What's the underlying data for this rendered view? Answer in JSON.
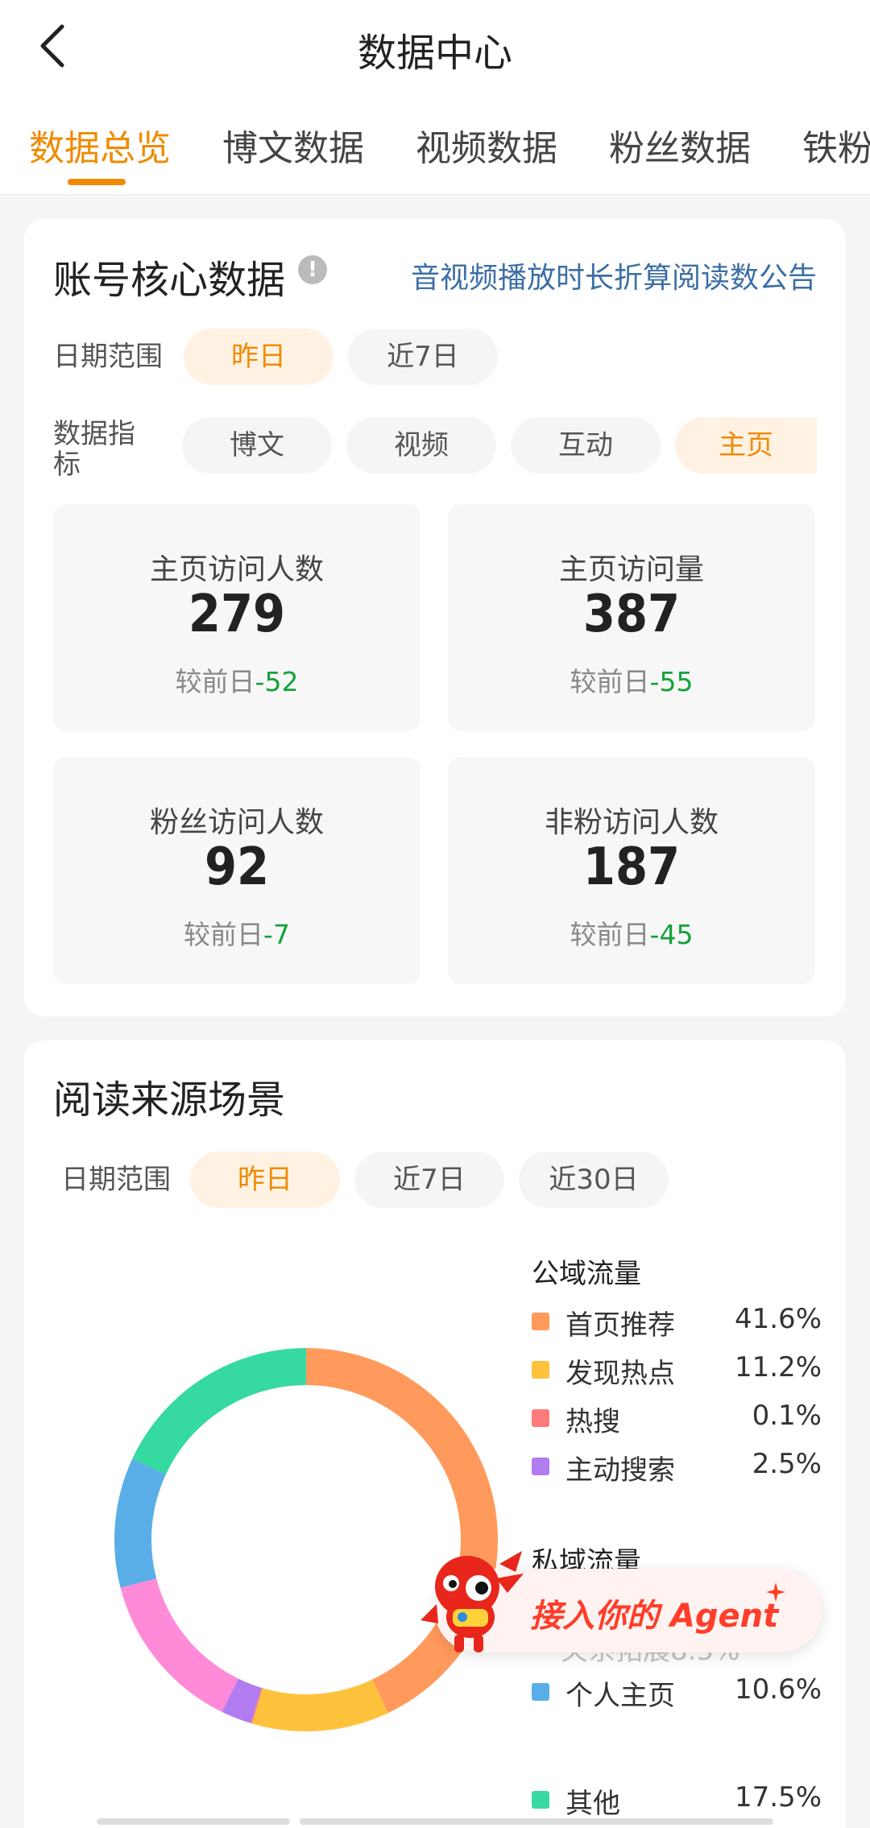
{
  "header": {
    "title": "数据中心",
    "tabs": [
      {
        "label": "数据总览",
        "active": true
      },
      {
        "label": "博文数据",
        "active": false
      },
      {
        "label": "视频数据",
        "active": false
      },
      {
        "label": "粉丝数据",
        "active": false
      },
      {
        "label": "铁粉",
        "active": false
      }
    ]
  },
  "core": {
    "title": "账号核心数据",
    "info_icon": "info-icon",
    "notice_link": "音视频播放时长折算阅读数公告",
    "date_label": "日期范围",
    "date_options": [
      {
        "label": "昨日",
        "active": true
      },
      {
        "label": "近7日",
        "active": false
      }
    ],
    "metric_label": "数据指标",
    "metric_options": [
      {
        "label": "博文",
        "active": false
      },
      {
        "label": "视频",
        "active": false
      },
      {
        "label": "互动",
        "active": false
      },
      {
        "label": "主页",
        "active": true
      }
    ],
    "stats": [
      {
        "label": "主页访问人数",
        "value": "279",
        "compare_prefix": "较前日",
        "delta": "-52"
      },
      {
        "label": "主页访问量",
        "value": "387",
        "compare_prefix": "较前日",
        "delta": "-55"
      },
      {
        "label": "粉丝访问人数",
        "value": "92",
        "compare_prefix": "较前日",
        "delta": "-7"
      },
      {
        "label": "非粉访问人数",
        "value": "187",
        "compare_prefix": "较前日",
        "delta": "-45"
      }
    ],
    "delta_color": "#12a33a"
  },
  "source": {
    "title": "阅读来源场景",
    "date_label": "日期范围",
    "date_options": [
      {
        "label": "昨日",
        "active": true
      },
      {
        "label": "近7日",
        "active": false
      },
      {
        "label": "近30日",
        "active": false
      }
    ],
    "public_label": "公域流量",
    "private_label": "私域流量",
    "public_items": [
      {
        "name": "首页推荐",
        "pct": "41.6%",
        "color": "#ff9a5c"
      },
      {
        "name": "发现热点",
        "pct": "11.2%",
        "color": "#ffc23d"
      },
      {
        "name": "热搜",
        "pct": "0.1%",
        "color": "#ff7a7a"
      },
      {
        "name": "主动搜索",
        "pct": "2.5%",
        "color": "#b07cf0"
      }
    ],
    "private_items": [
      {
        "name": "个人主页",
        "pct": "10.6%",
        "color": "#5aaee8"
      }
    ],
    "other_items": [
      {
        "name": "其他",
        "pct": "17.5%",
        "color": "#36d9a0"
      }
    ],
    "partial_text": "关系拓展8.5%"
  },
  "chart_data": {
    "type": "pie",
    "donut": true,
    "slices": [
      {
        "name": "首页推荐",
        "value": 41.6,
        "color": "#ff9a5c"
      },
      {
        "name": "发现热点",
        "value": 11.2,
        "color": "#ffc23d"
      },
      {
        "name": "热搜",
        "value": 0.1,
        "color": "#ff7a7a"
      },
      {
        "name": "主动搜索",
        "value": 2.5,
        "color": "#b07cf0"
      },
      {
        "name": "",
        "value": 13.3,
        "color": "#ff8ad8"
      },
      {
        "name": "个人主页",
        "value": 10.6,
        "color": "#5aaee8"
      },
      {
        "name": "其他",
        "value": 17.5,
        "color": "#36d9a0"
      }
    ]
  },
  "agent_banner": {
    "text": "接入你的 Agent",
    "mascot_icon": "lobster-mascot-icon",
    "accent": "#ff3d2a"
  },
  "colors": {
    "accent": "#f08a00",
    "link": "#3d6fa5"
  }
}
